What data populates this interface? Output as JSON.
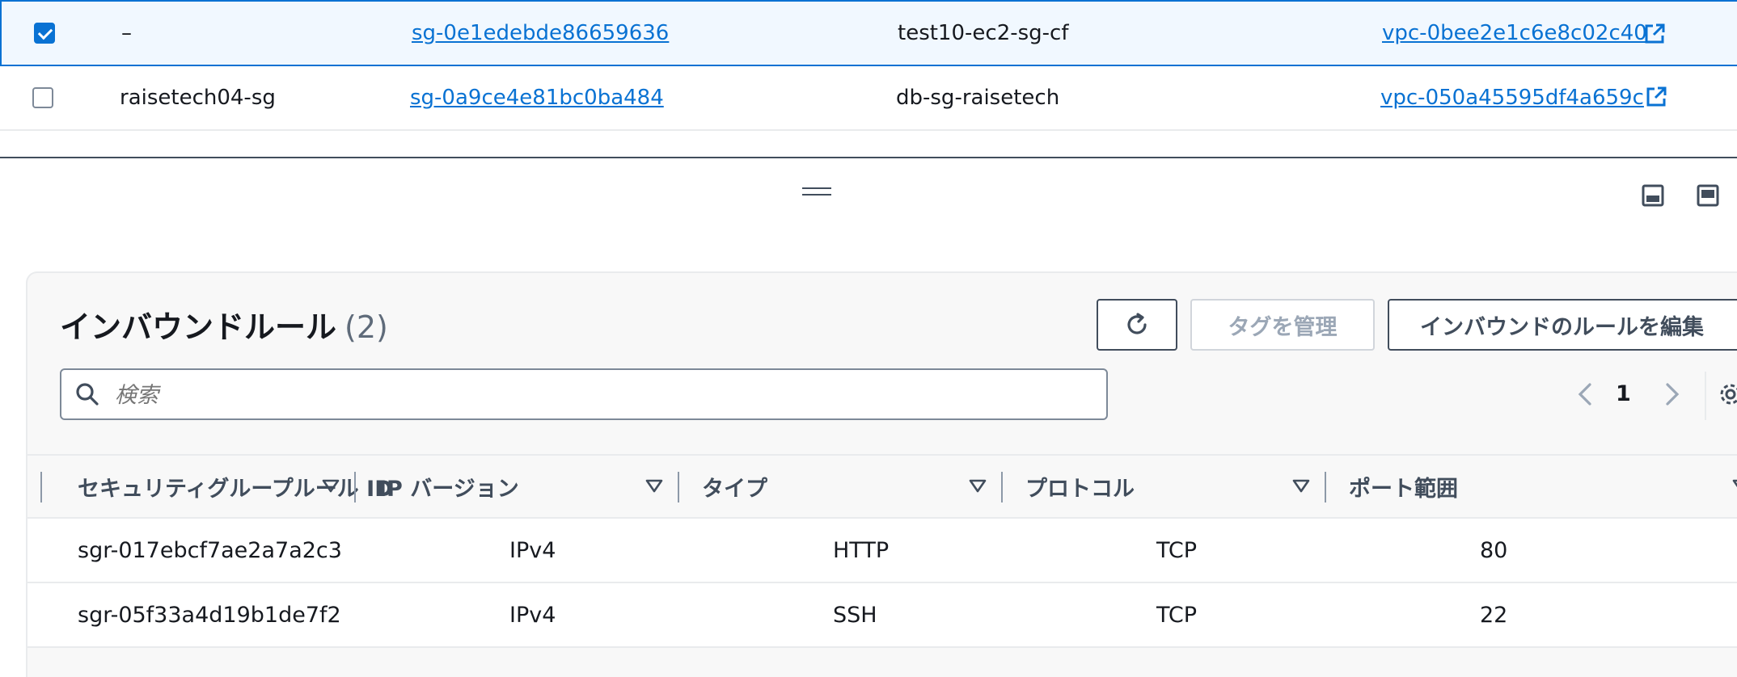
{
  "security_groups": {
    "rows": [
      {
        "selected": true,
        "name": "–",
        "group_id": "sg-0e1edebde86659636",
        "group_name": "test10-ec2-sg-cf",
        "vpc_id": "vpc-0bee2e1c6e8c02c40"
      },
      {
        "selected": false,
        "name": "raisetech04-sg",
        "group_id": "sg-0a9ce4e81bc0ba484",
        "group_name": "db-sg-raisetech",
        "vpc_id": "vpc-050a45595df4a659c"
      }
    ]
  },
  "split_panel": {
    "icons": {
      "drag_handle": "drag-handle-icon",
      "position_bottom": "panel-bottom-icon",
      "position_side": "panel-side-icon"
    }
  },
  "inbound": {
    "title": "インバウンドルール",
    "count": "(2)",
    "manage_tags_label": "タグを管理",
    "edit_rules_label": "インバウンドのルールを編集",
    "search_placeholder": "検索",
    "page_number": "1",
    "columns": [
      "セキュリティグループルール ID",
      "IP バージョン",
      "タイプ",
      "プロトコル",
      "ポート範囲"
    ],
    "rows": [
      {
        "rule_id": "sgr-017ebcf7ae2a7a2c3",
        "ip_version": "IPv4",
        "type": "HTTP",
        "protocol": "TCP",
        "port_range": "80"
      },
      {
        "rule_id": "sgr-05f33a4d19b1de7f2",
        "ip_version": "IPv4",
        "type": "SSH",
        "protocol": "TCP",
        "port_range": "22"
      }
    ]
  },
  "colors": {
    "link": "#0972d3",
    "selected_bg": "#f1f8ff",
    "border": "#414d5c"
  }
}
